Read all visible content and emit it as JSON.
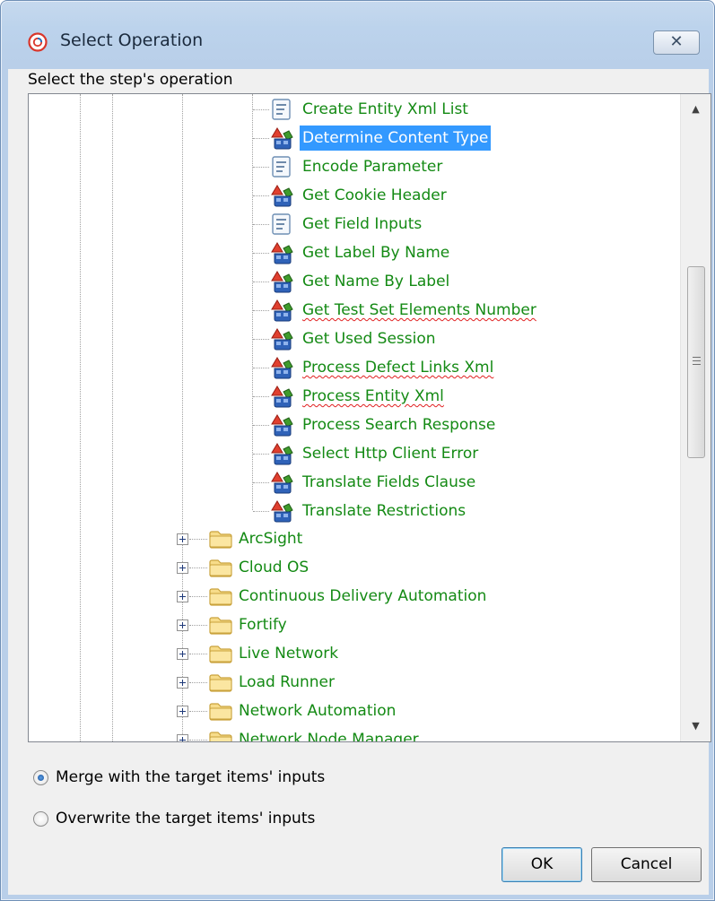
{
  "window": {
    "title": "Select Operation",
    "close_glyph": "✕"
  },
  "prompt": "Select the step's operation",
  "tree": {
    "operations": [
      {
        "label": "Create Entity Xml List",
        "icon": "script-icon",
        "selected": false,
        "misspelled": false
      },
      {
        "label": "Determine Content Type",
        "icon": "flow-icon",
        "selected": true,
        "misspelled": false
      },
      {
        "label": "Encode Parameter",
        "icon": "script-icon",
        "selected": false,
        "misspelled": false
      },
      {
        "label": "Get Cookie Header",
        "icon": "flow-icon",
        "selected": false,
        "misspelled": false
      },
      {
        "label": "Get Field Inputs",
        "icon": "script-icon",
        "selected": false,
        "misspelled": false
      },
      {
        "label": "Get Label By Name",
        "icon": "flow-icon",
        "selected": false,
        "misspelled": false
      },
      {
        "label": "Get Name By Label",
        "icon": "flow-icon",
        "selected": false,
        "misspelled": false
      },
      {
        "label": "Get Test Set Elements Number",
        "icon": "flow-icon",
        "selected": false,
        "misspelled": true
      },
      {
        "label": "Get Used Session",
        "icon": "flow-icon",
        "selected": false,
        "misspelled": false
      },
      {
        "label": "Process Defect Links Xml",
        "icon": "flow-icon",
        "selected": false,
        "misspelled": true
      },
      {
        "label": "Process Entity Xml",
        "icon": "flow-icon",
        "selected": false,
        "misspelled": true
      },
      {
        "label": "Process Search Response",
        "icon": "flow-icon",
        "selected": false,
        "misspelled": false
      },
      {
        "label": "Select Http Client Error",
        "icon": "flow-icon",
        "selected": false,
        "misspelled": false
      },
      {
        "label": "Translate Fields Clause",
        "icon": "flow-icon",
        "selected": false,
        "misspelled": false
      },
      {
        "label": "Translate Restrictions",
        "icon": "flow-icon",
        "selected": false,
        "misspelled": false
      }
    ],
    "folders": [
      {
        "label": "ArcSight",
        "icon": "folder-icon"
      },
      {
        "label": "Cloud OS",
        "icon": "folder-icon"
      },
      {
        "label": "Continuous Delivery Automation",
        "icon": "folder-icon"
      },
      {
        "label": "Fortify",
        "icon": "folder-icon"
      },
      {
        "label": "Live Network",
        "icon": "folder-icon"
      },
      {
        "label": "Load Runner",
        "icon": "folder-icon"
      },
      {
        "label": "Network Automation",
        "icon": "folder-icon"
      },
      {
        "label": "Network Node Manager",
        "icon": "folder-icon"
      }
    ]
  },
  "options": {
    "merge_label": "Merge with the target items' inputs",
    "overwrite_label": "Overwrite the target items' inputs",
    "selected": "merge"
  },
  "buttons": {
    "ok_label": "OK",
    "cancel_label": "Cancel"
  },
  "colors": {
    "item_text": "#148a14",
    "selection": "#3399ff"
  }
}
